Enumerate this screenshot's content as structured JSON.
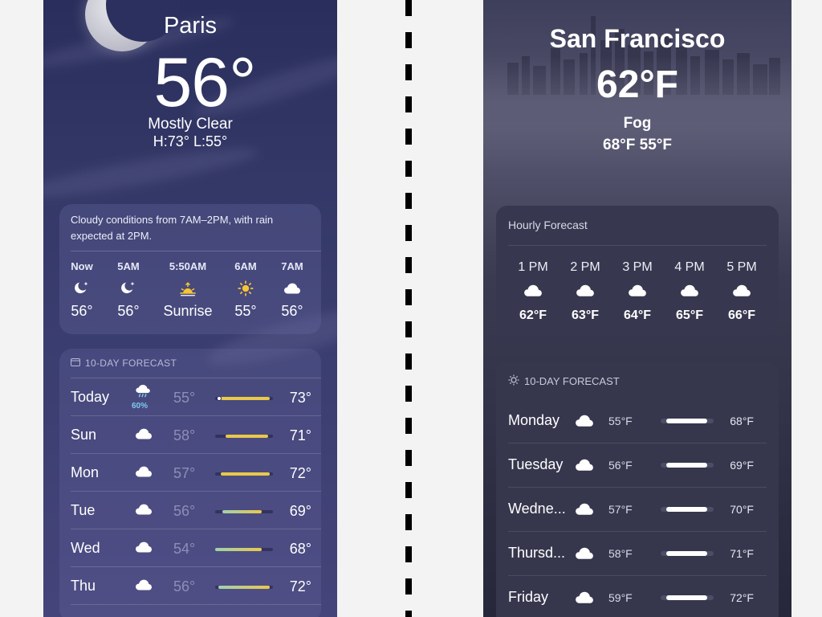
{
  "paris": {
    "city": "Paris",
    "temperature": "56°",
    "condition": "Mostly Clear",
    "high_low": "H:73°  L:55°",
    "summary": "Cloudy conditions from 7AM–2PM, with rain expected at 2PM.",
    "hourly": [
      {
        "time": "Now",
        "icon": "moon-star-icon",
        "value": "56°"
      },
      {
        "time": "5AM",
        "icon": "moon-star-icon",
        "value": "56°"
      },
      {
        "time": "5:50AM",
        "icon": "sunrise-icon",
        "value": "Sunrise"
      },
      {
        "time": "6AM",
        "icon": "sun-icon",
        "value": "55°"
      },
      {
        "time": "7AM",
        "icon": "cloud-icon",
        "value": "56°"
      }
    ],
    "forecast_title": "10-DAY FORECAST",
    "forecast": [
      {
        "day": "Today",
        "icon": "cloud-rain-icon",
        "precip": "60%",
        "low": "55°",
        "high": "73°",
        "range_start": 0.1,
        "range_end": 0.95,
        "current": true
      },
      {
        "day": "Sun",
        "icon": "cloud-icon",
        "low": "58°",
        "high": "71°",
        "range_start": 0.18,
        "range_end": 0.92
      },
      {
        "day": "Mon",
        "icon": "cloud-icon",
        "low": "57°",
        "high": "72°",
        "range_start": 0.1,
        "range_end": 0.95
      },
      {
        "day": "Tue",
        "icon": "cloud-icon",
        "low": "56°",
        "high": "69°",
        "range_start": 0.12,
        "range_end": 0.8
      },
      {
        "day": "Wed",
        "icon": "cloud-icon",
        "low": "54°",
        "high": "68°",
        "range_start": 0.0,
        "range_end": 0.8
      },
      {
        "day": "Thu",
        "icon": "cloud-icon",
        "low": "56°",
        "high": "72°",
        "range_start": 0.05,
        "range_end": 0.95
      }
    ]
  },
  "sf": {
    "city": "San Francisco",
    "temperature": "62°F",
    "condition": "Fog",
    "high_low": "68°F  55°F",
    "hourly_title": "Hourly Forecast",
    "hourly": [
      {
        "time": "1 PM",
        "icon": "cloud-icon",
        "value": "62°F"
      },
      {
        "time": "2 PM",
        "icon": "cloud-icon",
        "value": "63°F"
      },
      {
        "time": "3 PM",
        "icon": "cloud-icon",
        "value": "64°F"
      },
      {
        "time": "4 PM",
        "icon": "cloud-icon",
        "value": "65°F"
      },
      {
        "time": "5 PM",
        "icon": "cloud-icon",
        "value": "66°F"
      }
    ],
    "forecast_title": "10-DAY FORECAST",
    "forecast": [
      {
        "day": "Monday",
        "icon": "cloud-icon",
        "low": "55°F",
        "high": "68°F",
        "range_start": 0.1,
        "range_end": 0.88
      },
      {
        "day": "Tuesday",
        "icon": "cloud-icon",
        "low": "56°F",
        "high": "69°F",
        "range_start": 0.1,
        "range_end": 0.88
      },
      {
        "day": "Wedne...",
        "icon": "cloud-icon",
        "low": "57°F",
        "high": "70°F",
        "range_start": 0.1,
        "range_end": 0.88
      },
      {
        "day": "Thursd...",
        "icon": "cloud-icon",
        "low": "58°F",
        "high": "71°F",
        "range_start": 0.1,
        "range_end": 0.88
      },
      {
        "day": "Friday",
        "icon": "cloud-icon",
        "low": "59°F",
        "high": "72°F",
        "range_start": 0.1,
        "range_end": 0.88
      }
    ]
  },
  "colors": {
    "paris_gradient_warm": "#e9c84a",
    "paris_gradient_cool": "#9fd0b0",
    "precip_blue": "#7fc8f2",
    "sun_yellow": "#f7c533"
  }
}
